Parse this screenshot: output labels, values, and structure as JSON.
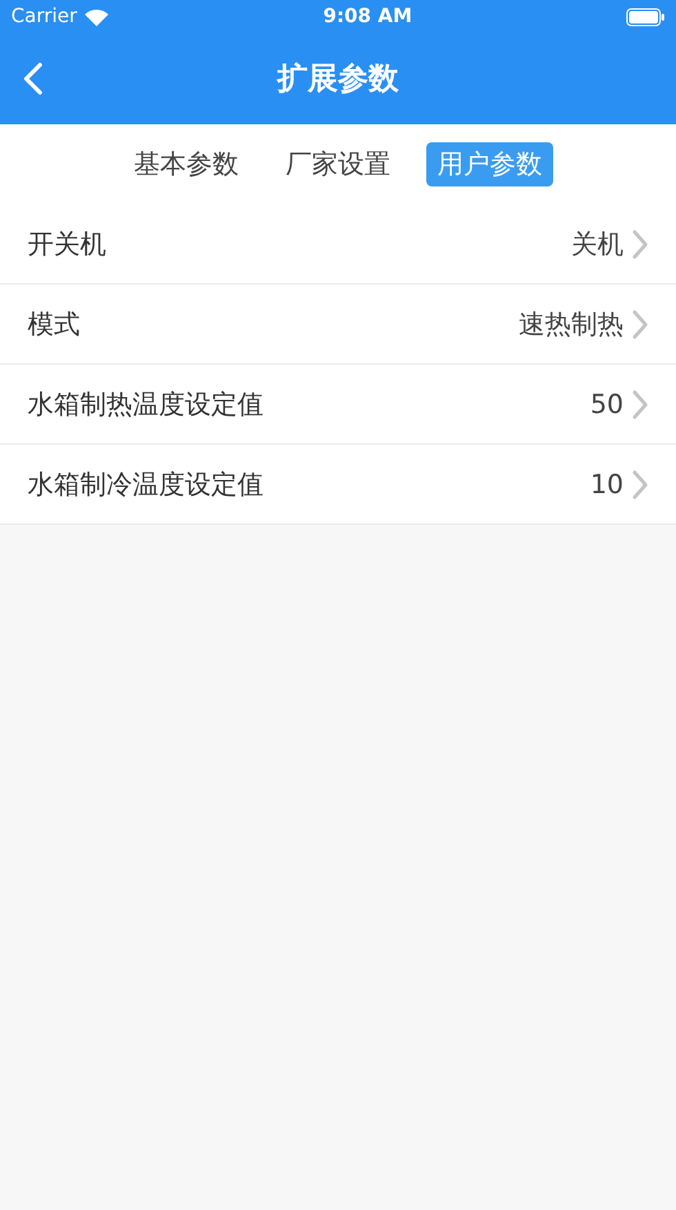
{
  "status_bar": {
    "carrier": "Carrier",
    "time": "9:08 AM"
  },
  "nav": {
    "title": "扩展参数"
  },
  "tabs": [
    {
      "label": "基本参数",
      "selected": false
    },
    {
      "label": "厂家设置",
      "selected": false
    },
    {
      "label": "用户参数",
      "selected": true
    }
  ],
  "rows": [
    {
      "label": "开关机",
      "value": "关机"
    },
    {
      "label": "模式",
      "value": "速热制热"
    },
    {
      "label": "水箱制热温度设定值",
      "value": "50"
    },
    {
      "label": "水箱制冷温度设定值",
      "value": "10"
    }
  ]
}
